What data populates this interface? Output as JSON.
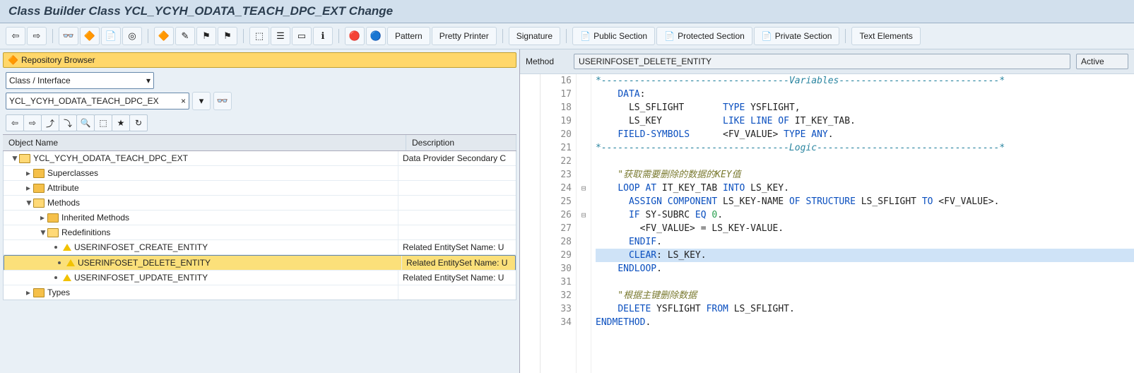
{
  "title": "Class Builder Class YCL_YCYH_ODATA_TEACH_DPC_EXT Change",
  "toolbar": {
    "pattern": "Pattern",
    "pretty": "Pretty Printer",
    "signature": "Signature",
    "public": "Public Section",
    "protected": "Protected Section",
    "private": "Private Section",
    "text_elements": "Text Elements"
  },
  "repo_browser": "Repository Browser",
  "filter_type": "Class / Interface",
  "filter_value": "YCL_YCYH_ODATA_TEACH_DPC_EX",
  "grid": {
    "col1": "Object Name",
    "col2": "Description"
  },
  "tree": [
    {
      "indent": 0,
      "exp": "▼",
      "icon": "folder-open",
      "label": "YCL_YCYH_ODATA_TEACH_DPC_EXT",
      "desc": "Data Provider Secondary C",
      "sel": false
    },
    {
      "indent": 1,
      "exp": "▸",
      "icon": "folder",
      "label": "Superclasses",
      "desc": "",
      "sel": false
    },
    {
      "indent": 1,
      "exp": "▸",
      "icon": "folder",
      "label": "Attribute",
      "desc": "",
      "sel": false
    },
    {
      "indent": 1,
      "exp": "▼",
      "icon": "folder-open",
      "label": "Methods",
      "desc": "",
      "sel": false
    },
    {
      "indent": 2,
      "exp": "▸",
      "icon": "folder",
      "label": "Inherited Methods",
      "desc": "",
      "sel": false
    },
    {
      "indent": 2,
      "exp": "▼",
      "icon": "folder-open",
      "label": "Redefinitions",
      "desc": "",
      "sel": false
    },
    {
      "indent": 3,
      "exp": "",
      "icon": "method",
      "label": "USERINFOSET_CREATE_ENTITY",
      "desc": "Related EntitySet Name: U",
      "sel": false
    },
    {
      "indent": 3,
      "exp": "",
      "icon": "method",
      "label": "USERINFOSET_DELETE_ENTITY",
      "desc": "Related EntitySet Name: U",
      "sel": true
    },
    {
      "indent": 3,
      "exp": "",
      "icon": "method",
      "label": "USERINFOSET_UPDATE_ENTITY",
      "desc": "Related EntitySet Name: U",
      "sel": false
    },
    {
      "indent": 1,
      "exp": "▸",
      "icon": "folder",
      "label": "Types",
      "desc": "",
      "sel": false
    }
  ],
  "right": {
    "label_method": "Method",
    "method_name": "USERINFOSET_DELETE_ENTITY",
    "status": "Active"
  },
  "code": {
    "start": 16,
    "highlight_line": 29,
    "fold": {
      "24": "⊟",
      "26": "⊟"
    },
    "lines": [
      {
        "t": "cmt",
        "txt": "*----------------------------------Variables-----------------------------*"
      },
      {
        "t": "kw",
        "txt": "    DATA:"
      },
      {
        "t": "decl",
        "txt": "      LS_SFLIGHT       TYPE YSFLIGHT,"
      },
      {
        "t": "decl",
        "txt": "      LS_KEY           LIKE LINE OF IT_KEY_TAB."
      },
      {
        "t": "decl",
        "txt": "    FIELD-SYMBOLS      <FV_VALUE> TYPE ANY."
      },
      {
        "t": "cmt",
        "txt": "*----------------------------------Logic---------------------------------*"
      },
      {
        "t": "",
        "txt": ""
      },
      {
        "t": "str",
        "txt": "    \"获取需要删除的数据的KEY值"
      },
      {
        "t": "loop",
        "txt": "    LOOP AT IT_KEY_TAB INTO LS_KEY."
      },
      {
        "t": "assg",
        "txt": "      ASSIGN COMPONENT LS_KEY-NAME OF STRUCTURE LS_SFLIGHT TO <FV_VALUE>."
      },
      {
        "t": "if",
        "txt": "      IF SY-SUBRC EQ 0."
      },
      {
        "t": "plain",
        "txt": "        <FV_VALUE> = LS_KEY-VALUE."
      },
      {
        "t": "kw",
        "txt": "      ENDIF."
      },
      {
        "t": "clr",
        "txt": "      CLEAR: LS_KEY."
      },
      {
        "t": "kw",
        "txt": "    ENDLOOP."
      },
      {
        "t": "",
        "txt": ""
      },
      {
        "t": "str",
        "txt": "    \"根据主键删除数据"
      },
      {
        "t": "del",
        "txt": "    DELETE YSFLIGHT FROM LS_SFLIGHT."
      },
      {
        "t": "kw",
        "txt": "ENDMETHOD."
      }
    ]
  }
}
